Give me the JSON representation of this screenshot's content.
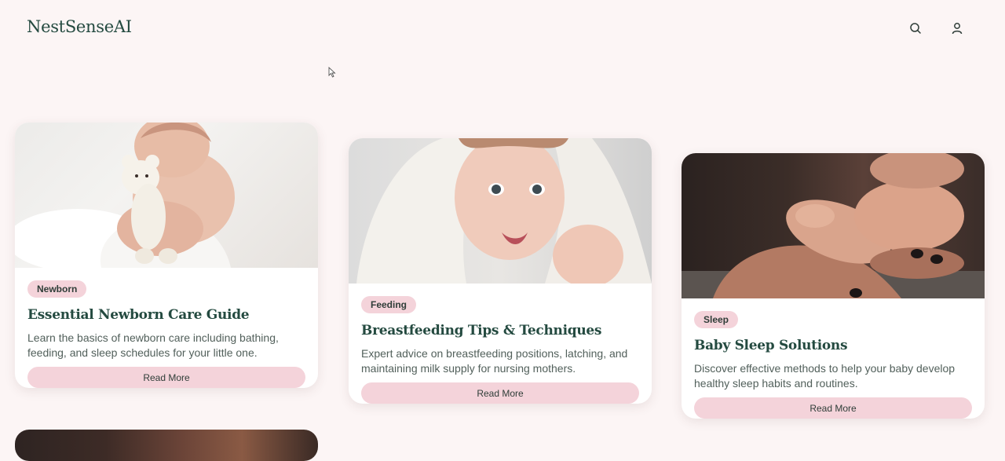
{
  "header": {
    "logo": "NestSenseAI",
    "icons": [
      "search-icon",
      "user-icon"
    ]
  },
  "colors": {
    "background": "#fcf5f5",
    "brand": "#244a40",
    "accent_pink": "#f4d3da"
  },
  "articles": [
    {
      "tag": "Newborn",
      "title": "Essential Newborn Care Guide",
      "description": "Learn the basics of newborn care including bathing, feeding, and sleep schedules for your little one.",
      "button": "Read More"
    },
    {
      "tag": "Feeding",
      "title": "Breastfeeding Tips & Techniques",
      "description": "Expert advice on breastfeeding positions, latching, and maintaining milk supply for nursing mothers.",
      "button": "Read More"
    },
    {
      "tag": "Sleep",
      "title": "Baby Sleep Solutions",
      "description": "Discover effective methods to help your baby develop healthy sleep habits and routines.",
      "button": "Read More"
    }
  ]
}
